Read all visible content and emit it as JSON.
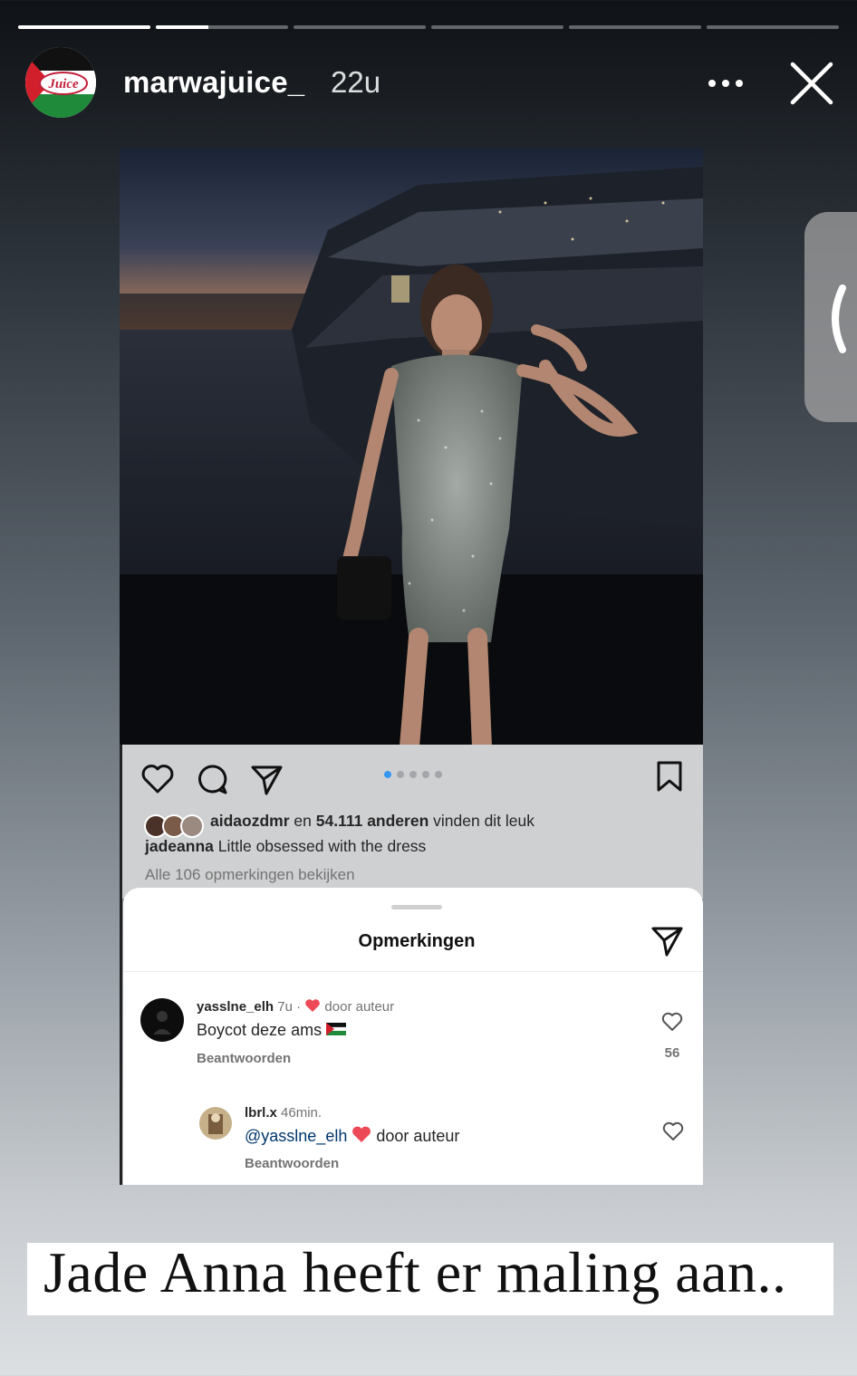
{
  "story": {
    "progress": {
      "segments": 6,
      "current_index": 1,
      "current_fill": 0.4
    },
    "header": {
      "username": "marwajuice_",
      "time_ago": "22u",
      "avatar_logo_text": "Juice"
    }
  },
  "post": {
    "image_dots": {
      "count": 5,
      "active_index": 0
    },
    "likes": {
      "first_liker": "aidaozdmr",
      "connector": " en ",
      "others": "54.111 anderen",
      "suffix": " vinden dit leuk"
    },
    "caption": {
      "author": "jadeanna",
      "text": " Little obsessed with the dress"
    },
    "view_all_comments": "Alle 106 opmerkingen bekijken"
  },
  "comments_sheet": {
    "title": "Opmerkingen",
    "comments": [
      {
        "username": "yasslne_elh",
        "time": " 7u · ",
        "by_author": " door auteur",
        "text": "Boycot deze ams ",
        "reply_label": "Beantwoorden",
        "like_count": "56"
      },
      {
        "username": "lbrl.x",
        "time": " 46min.",
        "mention": "@yasslne_elh",
        "by_author": " door auteur",
        "reply_label": "Beantwoorden"
      }
    ]
  },
  "overlay_caption": "Jade Anna heeft er maling aan..",
  "colors": {
    "link_blue": "#3897f0",
    "heart_red": "#ed4956",
    "mention_blue": "#00376b"
  },
  "icons": [
    "more-icon",
    "close-icon",
    "chevron-left-icon",
    "heart-icon",
    "comment-icon",
    "share-icon",
    "bookmark-icon",
    "send-icon",
    "red-heart-icon",
    "palestine-flag-icon"
  ]
}
